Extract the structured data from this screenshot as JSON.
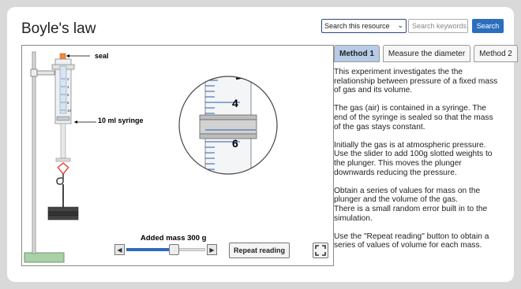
{
  "title": "Boyle's law",
  "search": {
    "scope_selected": "Search this resource",
    "placeholder": "Search keywords...",
    "button_label": "Search"
  },
  "simulation": {
    "seal_label": "seal",
    "syringe_label": "10 ml syringe",
    "syringe_scale_labels": [
      "2",
      "4",
      "6",
      "8",
      "10"
    ],
    "zoom_scale_labels": [
      "4",
      "6"
    ],
    "added_mass_label": "Added mass 300 g",
    "added_mass_fraction": 0.6,
    "repeat_button": "Repeat reading"
  },
  "tabs": [
    {
      "label": "Method 1",
      "active": true
    },
    {
      "label": "Measure the diameter",
      "active": false
    },
    {
      "label": "Method 2",
      "active": false
    }
  ],
  "description": [
    "This experiment investigates the the relationship between pressure of a fixed mass of gas and its volume.",
    "The gas (air) is contained in a syringe. The end of the syringe is sealed so that the mass of the gas stays constant.",
    "Initially the gas is at atmospheric pressure. Use the slider to add 100g slotted weights to the plunger. This moves the plunger downwards reducing the pressure.",
    "Obtain a series of values for mass on the plunger and the volume of the gas.\nThere is a small random error built in to the simulation.",
    "Use the \"Repeat reading\" button to obtain a series of values of volume for each mass."
  ],
  "colors": {
    "accent": "#2a6fbd",
    "active_tab": "#b6cbe6",
    "seal": "#f28a3a",
    "base": "#a9d0a9"
  }
}
